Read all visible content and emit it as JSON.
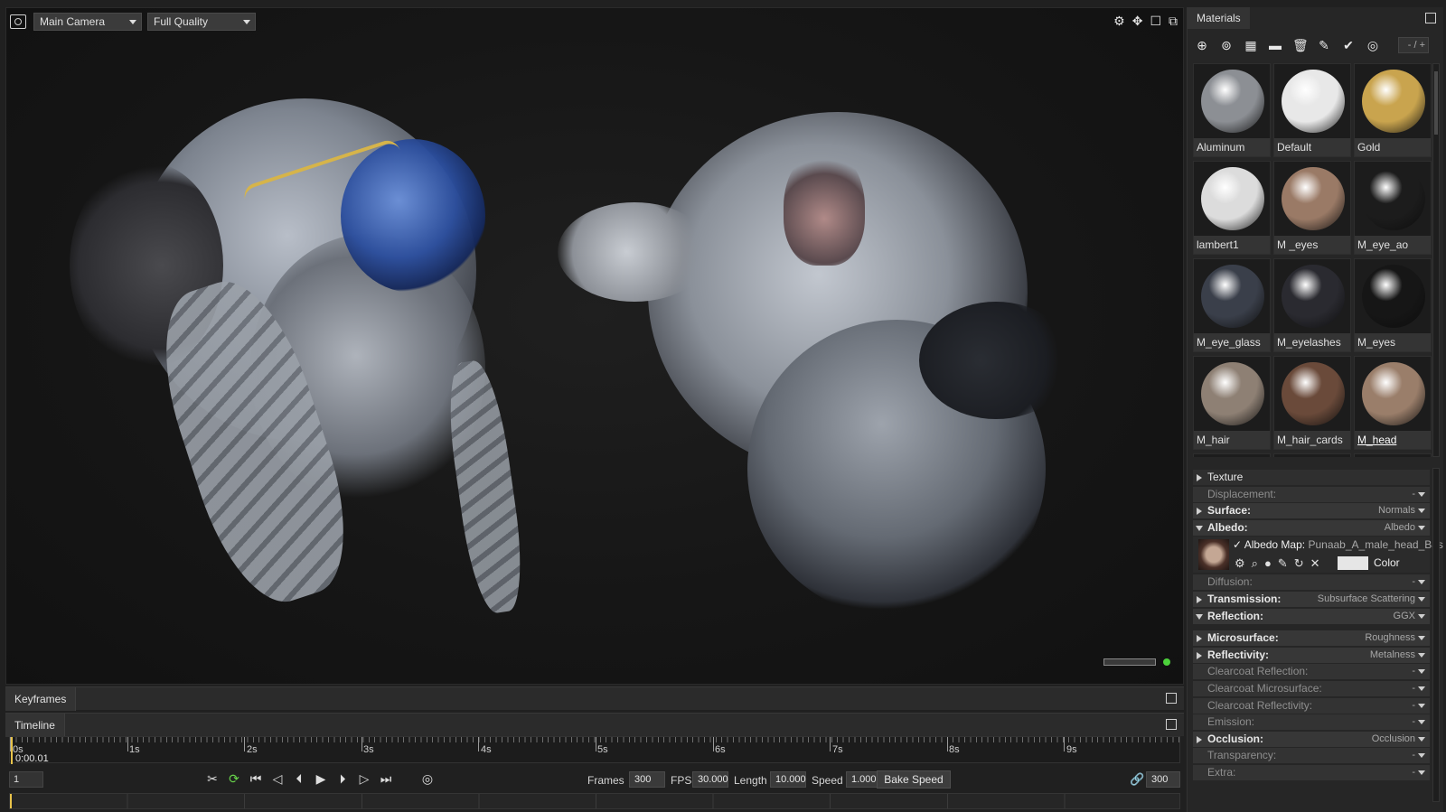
{
  "viewport": {
    "camera": "Main Camera",
    "quality": "Full Quality",
    "icons": [
      "gear-icon",
      "move-icon",
      "maximize-icon",
      "popout-icon"
    ]
  },
  "keyframes": {
    "title": "Keyframes"
  },
  "timeline": {
    "title": "Timeline",
    "ticks": [
      "0s",
      "1s",
      "2s",
      "3s",
      "4s",
      "5s",
      "6s",
      "7s",
      "8s",
      "9s"
    ],
    "current_time": "0:00.01",
    "current_frame": "1",
    "frames_label": "Frames",
    "frames": "300",
    "fps_label": "FPS",
    "fps": "30.000",
    "length_label": "Length",
    "length": "10.000",
    "speed_label": "Speed",
    "speed": "1.000",
    "bake_speed": "Bake Speed",
    "end_frame": "300"
  },
  "materials": {
    "title": "Materials",
    "page_indicator": "- / +",
    "items": [
      {
        "name": "Aluminum",
        "color": "#8c8f94"
      },
      {
        "name": "Default",
        "color": "#e8e8e8"
      },
      {
        "name": "Gold",
        "color": "#c9a44e"
      },
      {
        "name": "lambert1",
        "color": "#dcdcdc"
      },
      {
        "name": "M _eyes",
        "color": "#9a7a66"
      },
      {
        "name": "M_eye_ao",
        "color": "#1c1c1c"
      },
      {
        "name": "M_eye_glass",
        "color": "#3a3f4a"
      },
      {
        "name": "M_eyelashes",
        "color": "#2a2a30"
      },
      {
        "name": "M_eyes",
        "color": "#161616"
      },
      {
        "name": "M_hair",
        "color": "#8e8074"
      },
      {
        "name": "M_hair_cards",
        "color": "#6a4a3a"
      },
      {
        "name": "M_head",
        "color": "#9a7e6a"
      },
      {
        "name": "",
        "color": "#b8554a"
      },
      {
        "name": "",
        "color": "#2a2a2a"
      },
      {
        "name": "",
        "color": "#242424"
      }
    ]
  },
  "properties": {
    "texture": "Texture",
    "displacement": {
      "label": "Displacement:",
      "value": "-"
    },
    "surface": {
      "label": "Surface:",
      "value": "Normals"
    },
    "albedo": {
      "label": "Albedo:",
      "value": "Albedo"
    },
    "albedo_map": {
      "label": "Albedo Map:",
      "file": "Punaab_A_male_head_Bas",
      "color_label": "Color"
    },
    "diffusion": {
      "label": "Diffusion:",
      "value": "-"
    },
    "transmission": {
      "label": "Transmission:",
      "value": "Subsurface Scattering"
    },
    "reflection": {
      "label": "Reflection:",
      "value": "GGX"
    },
    "microsurface": {
      "label": "Microsurface:",
      "value": "Roughness"
    },
    "reflectivity": {
      "label": "Reflectivity:",
      "value": "Metalness"
    },
    "clearcoat_reflection": {
      "label": "Clearcoat Reflection:",
      "value": "-"
    },
    "clearcoat_microsurface": {
      "label": "Clearcoat Microsurface:",
      "value": "-"
    },
    "clearcoat_reflectivity": {
      "label": "Clearcoat Reflectivity:",
      "value": "-"
    },
    "emission": {
      "label": "Emission:",
      "value": "-"
    },
    "occlusion": {
      "label": "Occlusion:",
      "value": "Occlusion"
    },
    "transparency": {
      "label": "Transparency:",
      "value": "-"
    },
    "extra": {
      "label": "Extra:",
      "value": "-"
    }
  }
}
